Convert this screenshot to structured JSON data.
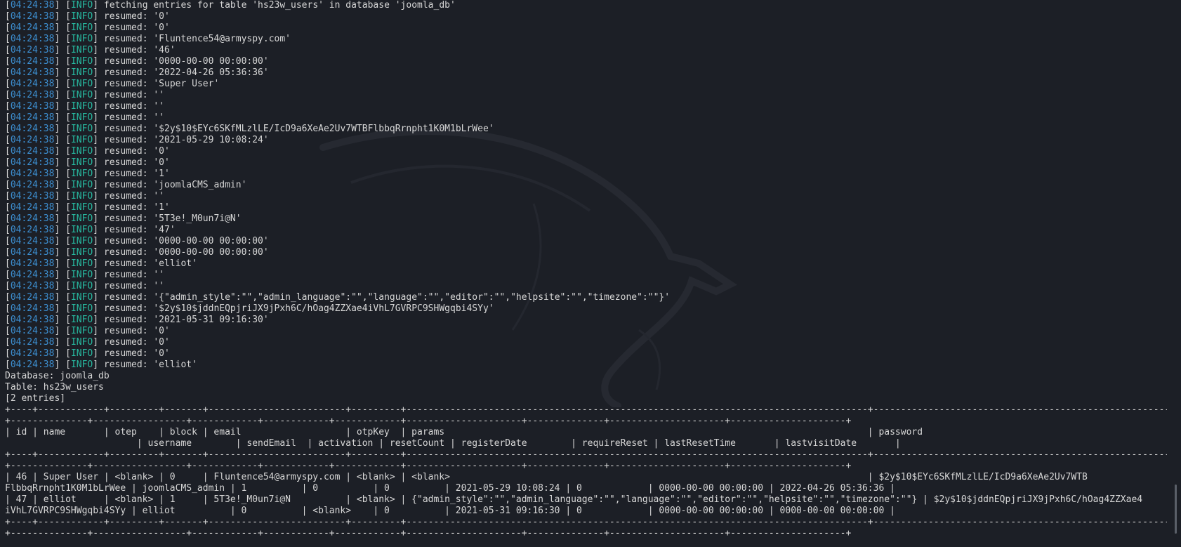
{
  "log": {
    "timestamp": "04:24:38",
    "level": "INFO",
    "lines": [
      "fetching entries for table 'hs23w_users' in database 'joomla_db'",
      "resumed: '0'",
      "resumed: '0'",
      "resumed: 'Fluntence54@armyspy.com'",
      "resumed: '46'",
      "resumed: '0000-00-00 00:00:00'",
      "resumed: '2022-04-26 05:36:36'",
      "resumed: 'Super User'",
      "resumed: ''",
      "resumed: ''",
      "resumed: ''",
      "resumed: '$2y$10$EYc6SKfMLzlLE/IcD9a6XeAe2Uv7WTBFlbbqRrnpht1K0M1bLrWee'",
      "resumed: '2021-05-29 10:08:24'",
      "resumed: '0'",
      "resumed: '0'",
      "resumed: '1'",
      "resumed: 'joomlaCMS_admin'",
      "resumed: ''",
      "resumed: '1'",
      "resumed: '5T3e!_M0un7i@N'",
      "resumed: '47'",
      "resumed: '0000-00-00 00:00:00'",
      "resumed: '0000-00-00 00:00:00'",
      "resumed: 'elliot'",
      "resumed: ''",
      "resumed: ''",
      "resumed: '{\"admin_style\":\"\",\"admin_language\":\"\",\"language\":\"\",\"editor\":\"\",\"helpsite\":\"\",\"timezone\":\"\"}'",
      "resumed: '$2y$10$jddnEQpjriJX9jPxh6C/hOag4ZZXae4iVhL7GVRPC9SHWgqbi4SYy'",
      "resumed: '2021-05-31 09:16:30'",
      "resumed: '0'",
      "resumed: '0'",
      "resumed: '0'",
      "resumed: 'elliot'"
    ]
  },
  "summary": {
    "database": "Database: joomla_db",
    "table": "Table: hs23w_users",
    "entries": "[2 entries]"
  },
  "table": {
    "lines": [
      "+----+------------+---------+-------+-------------------------+---------+------------------------------------------------------------------------------------+---------------------------------------------------------------+",
      "+--------------+-----------------+------------+------------+------------+---------------------+--------------+---------------------+---------------------+",
      "| id | name       | otep    | block | email                   | otpKey  | params                                                                             | password",
      "                        | username        | sendEmail  | activation | resetCount | registerDate        | requireReset | lastResetTime       | lastvisitDate       |",
      "+----+------------+---------+-------+-------------------------+---------+------------------------------------------------------------------------------------+---------------------------------------------------------------+",
      "+--------------+-----------------+------------+------------+------------+---------------------+--------------+---------------------+---------------------+",
      "| 46 | Super User | <blank> | 0     | Fluntence54@armyspy.com | <blank> | <blank>                                                                            | $2y$10$EYc6SKfMLzlLE/IcD9a6XeAe2Uv7WTB",
      "FlbbqRrnpht1K0M1bLrWee | joomlaCMS_admin | 1          | 0          | 0          | 2021-05-29 10:08:24 | 0            | 0000-00-00 00:00:00 | 2022-04-26 05:36:36 |",
      "| 47 | elliot     | <blank> | 1     | 5T3e!_M0un7i@N          | <blank> | {\"admin_style\":\"\",\"admin_language\":\"\",\"language\":\"\",\"editor\":\"\",\"helpsite\":\"\",\"timezone\":\"\"} | $2y$10$jddnEQpjriJX9jPxh6C/hOag4ZZXae4",
      "iVhL7GVRPC9SHWgqbi4SYy | elliot          | 0          | <blank>    | 0          | 2021-05-31 09:16:30 | 0            | 0000-00-00 00:00:00 | 0000-00-00 00:00:00 |",
      "+----+------------+---------+-------+-------------------------+---------+------------------------------------------------------------------------------------+---------------------------------------------------------------+",
      "+--------------+-----------------+------------+------------+------------+---------------------+--------------+---------------------+---------------------+"
    ]
  },
  "colors": {
    "background": "#1c1f26",
    "timestamp": "#3d8fd1",
    "level": "#27b9a0",
    "text": "#d7d7d7"
  },
  "icons": {
    "watermark": "kali-dragon-icon"
  }
}
